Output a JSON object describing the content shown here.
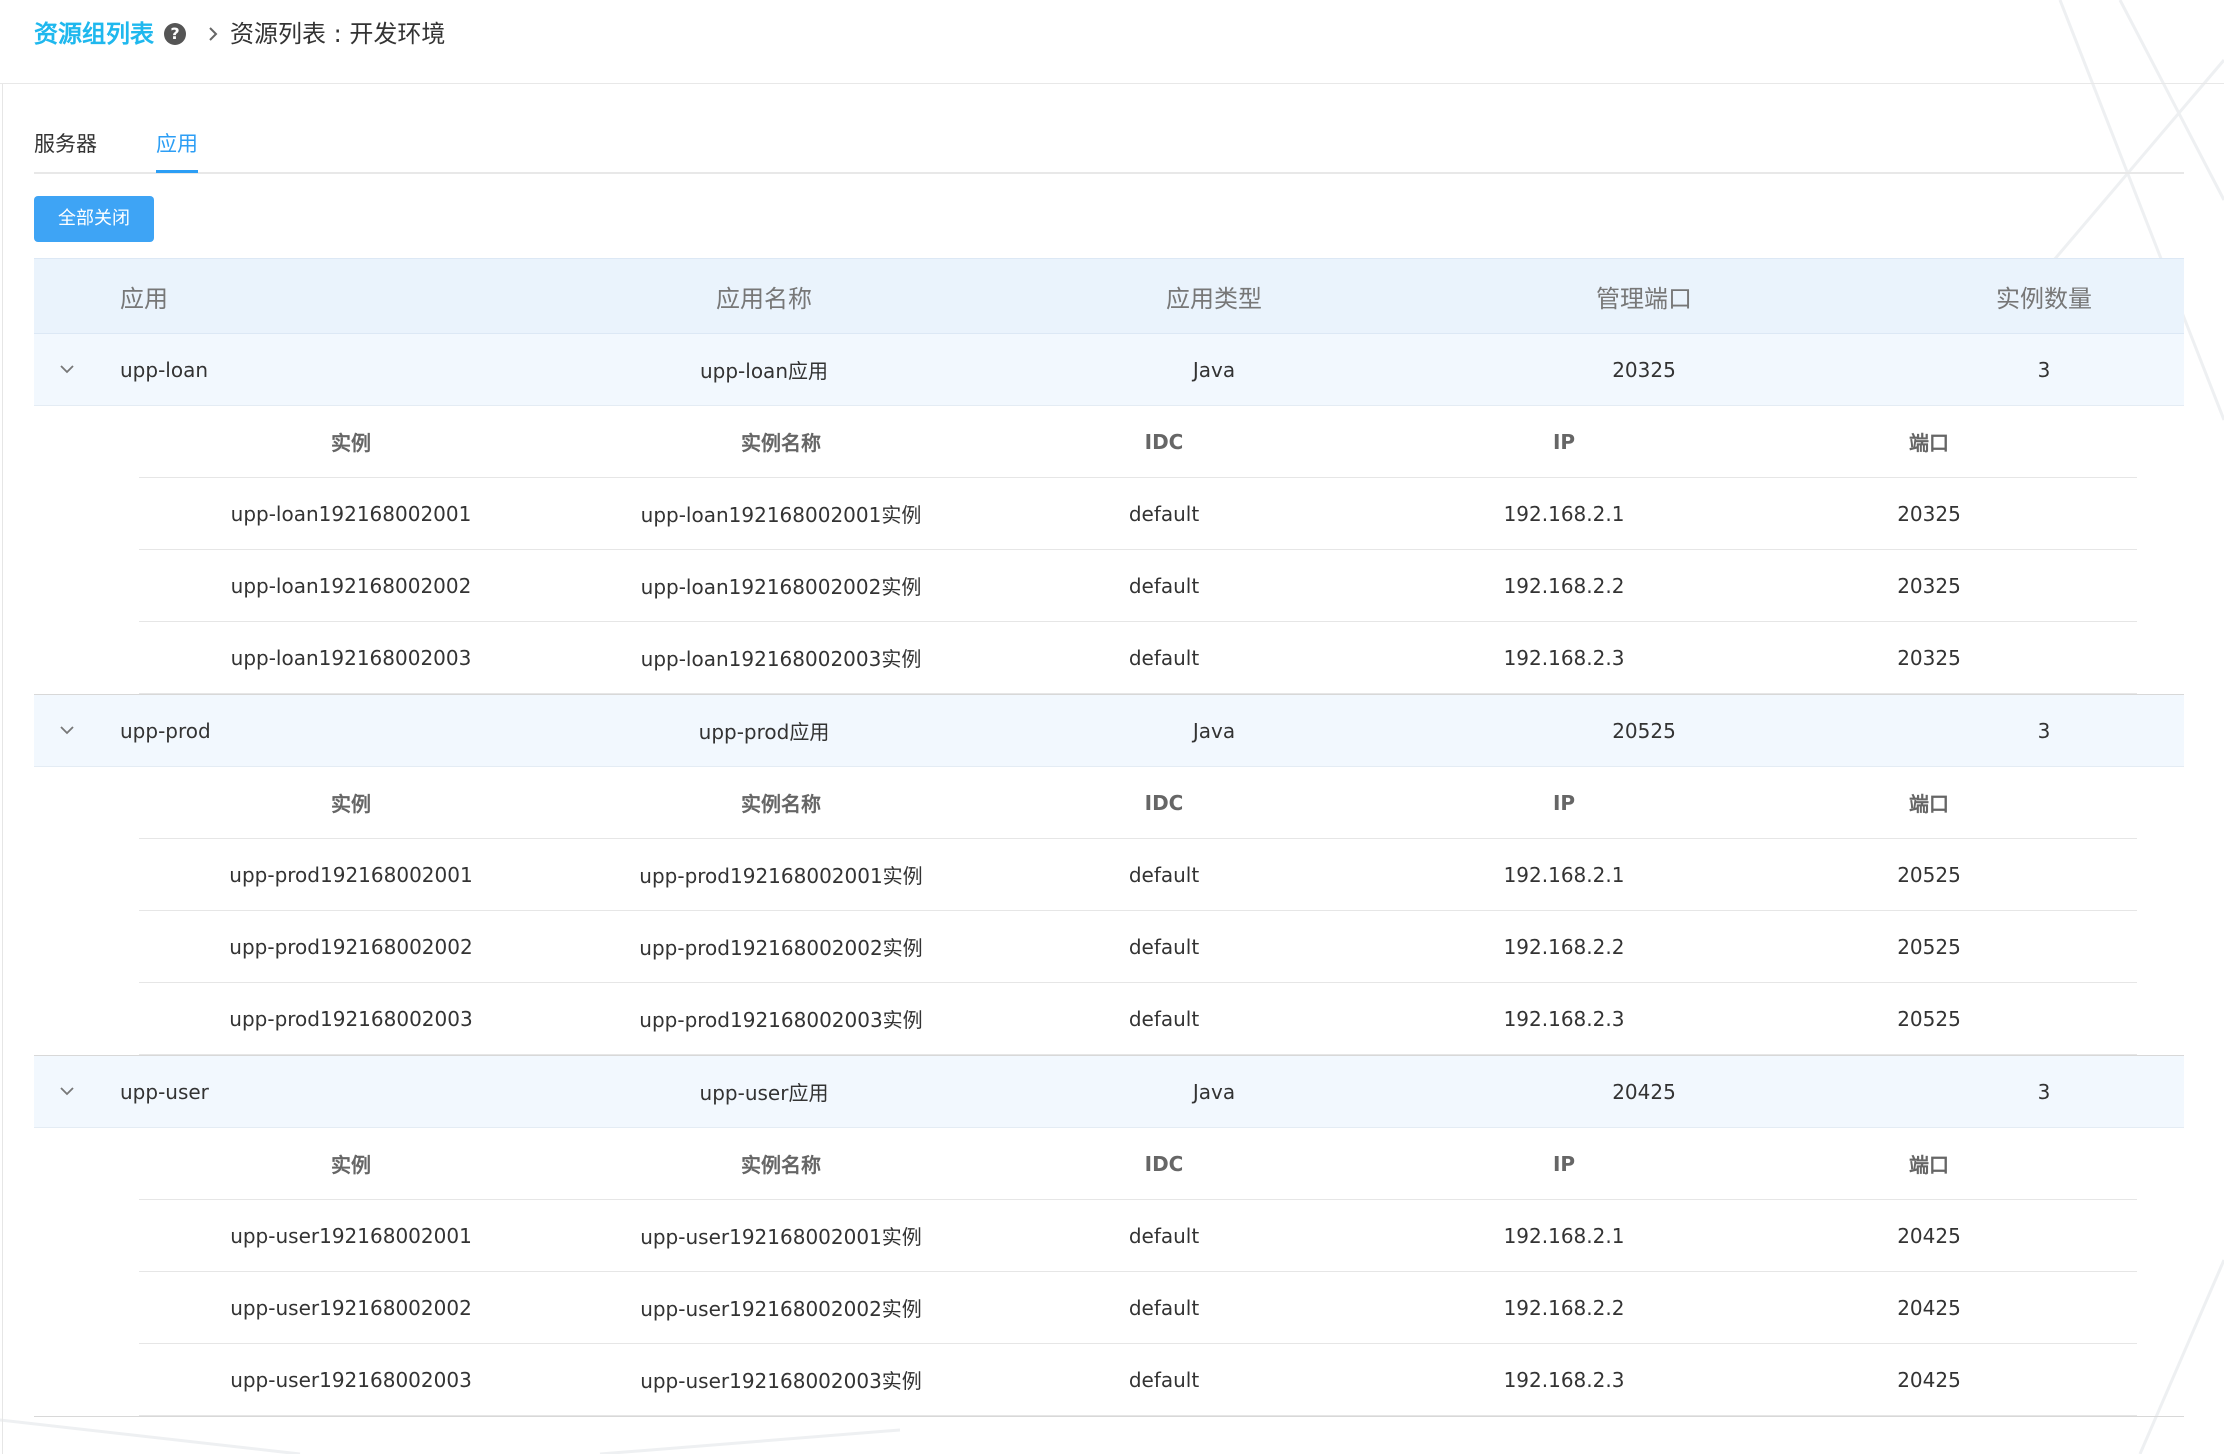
{
  "breadcrumb": {
    "root": "资源组列表",
    "current": "资源列表 : 开发环境"
  },
  "tabs": [
    {
      "label": "服务器",
      "active": false
    },
    {
      "label": "应用",
      "active": true
    }
  ],
  "toolbar": {
    "close_all_label": "全部关闭"
  },
  "colors": {
    "accent": "#2c9ef5",
    "breadcrumb_root": "#1fb8ee",
    "button_bg": "#3ea4f5",
    "header_bg": "#eaf3fc",
    "group_row_bg": "#f2f8fe"
  },
  "table": {
    "columns": [
      "应用",
      "应用名称",
      "应用类型",
      "管理端口",
      "实例数量"
    ],
    "sub_columns": [
      "实例",
      "实例名称",
      "IDC",
      "IP",
      "端口"
    ],
    "groups": [
      {
        "app": "upp-loan",
        "name": "upp-loan应用",
        "type": "Java",
        "port": "20325",
        "count": "3",
        "instances": [
          {
            "id": "upp-loan192168002001",
            "name": "upp-loan192168002001实例",
            "idc": "default",
            "ip": "192.168.2.1",
            "port": "20325"
          },
          {
            "id": "upp-loan192168002002",
            "name": "upp-loan192168002002实例",
            "idc": "default",
            "ip": "192.168.2.2",
            "port": "20325"
          },
          {
            "id": "upp-loan192168002003",
            "name": "upp-loan192168002003实例",
            "idc": "default",
            "ip": "192.168.2.3",
            "port": "20325"
          }
        ]
      },
      {
        "app": "upp-prod",
        "name": "upp-prod应用",
        "type": "Java",
        "port": "20525",
        "count": "3",
        "instances": [
          {
            "id": "upp-prod192168002001",
            "name": "upp-prod192168002001实例",
            "idc": "default",
            "ip": "192.168.2.1",
            "port": "20525"
          },
          {
            "id": "upp-prod192168002002",
            "name": "upp-prod192168002002实例",
            "idc": "default",
            "ip": "192.168.2.2",
            "port": "20525"
          },
          {
            "id": "upp-prod192168002003",
            "name": "upp-prod192168002003实例",
            "idc": "default",
            "ip": "192.168.2.3",
            "port": "20525"
          }
        ]
      },
      {
        "app": "upp-user",
        "name": "upp-user应用",
        "type": "Java",
        "port": "20425",
        "count": "3",
        "instances": [
          {
            "id": "upp-user192168002001",
            "name": "upp-user192168002001实例",
            "idc": "default",
            "ip": "192.168.2.1",
            "port": "20425"
          },
          {
            "id": "upp-user192168002002",
            "name": "upp-user192168002002实例",
            "idc": "default",
            "ip": "192.168.2.2",
            "port": "20425"
          },
          {
            "id": "upp-user192168002003",
            "name": "upp-user192168002003实例",
            "idc": "default",
            "ip": "192.168.2.3",
            "port": "20425"
          }
        ]
      }
    ]
  }
}
